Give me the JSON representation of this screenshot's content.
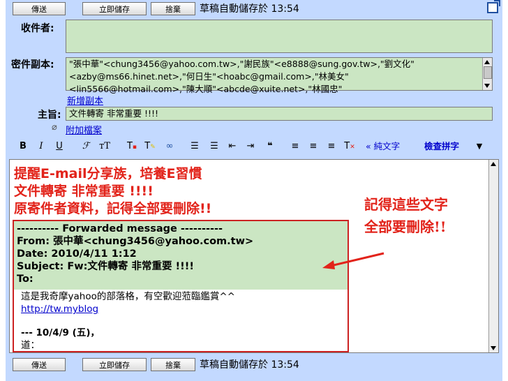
{
  "toolbar": {
    "send_label": "傳送",
    "save_label": "立即儲存",
    "discard_label": "捨棄",
    "autosave_text": "草稿自動儲存於 13:54"
  },
  "header": {
    "to_label": "收件者:",
    "to_value": "",
    "cc_label": "密件副本:",
    "cc_lines": [
      "\"張中華\"<chung3456@yahoo.com.tw>,\"謝民族\"<e8888@sung.gov.tw>,\"劉文化\"",
      "<azby@ms66.hinet.net>,\"何日生\"<hoabc@gmail.com>,\"林美女\"",
      "<lin5566@hotmail.com>,\"陳大順\"<abcde@xuite.net>,\"林國忠\""
    ],
    "add_cc_link": "新增副本",
    "subject_label": "主旨:",
    "subject_value": "文件轉寄 非常重要 !!!!",
    "attach_link": "附加檔案"
  },
  "format_toolbar": {
    "bold": "B",
    "italic": "I",
    "underline": "U",
    "font": "ℱ",
    "size": "тT",
    "plain_text_link": "« 純文字",
    "spellcheck_link": "檢查拼字"
  },
  "editor": {
    "headline_lines": [
      "提醒E-mail分享族，培養E習慣",
      "文件轉寄 非常重要 !!!!",
      "原寄件者資料，記得全部要刪除!!"
    ],
    "forward_lines": [
      "---------- Forwarded message ----------",
      "From: 張中華<chung3456@yahoo.com.tw>",
      "Date: 2010/4/11 1:12",
      "Subject: Fw:文件轉寄 非常重要 !!!!",
      "To:"
    ],
    "body_text": "這是我奇摩yahoo的部落格，有空歡迎蒞臨鑑賞^^",
    "body_link": "http://tw.myblog",
    "body_date": "--- 10/4/9 (五)，",
    "body_last": "道："
  },
  "annotation": {
    "line1": "記得這些文字",
    "line2": "全部要刪除!!"
  },
  "colors": {
    "toolbar_bg": "#c3d9ff",
    "field_bg": "#cbe6c3",
    "accent_red": "#e2231a",
    "link_blue": "#0000cc"
  }
}
